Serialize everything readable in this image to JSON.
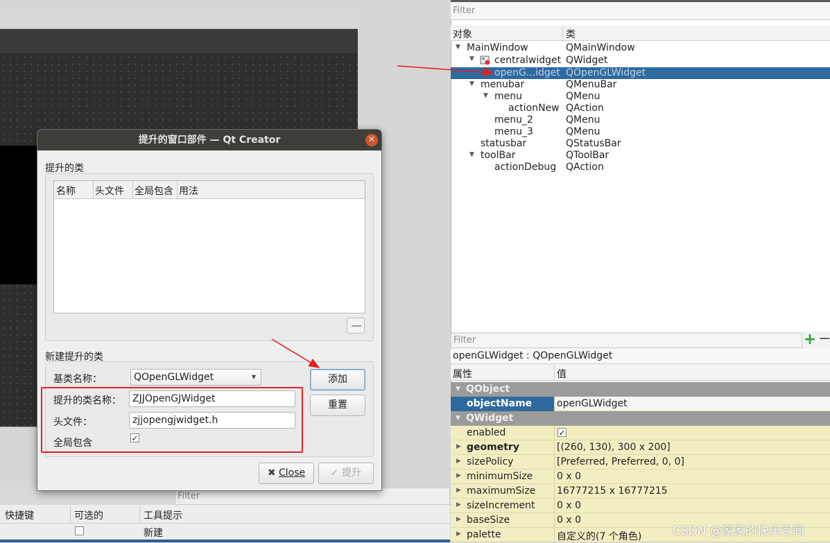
{
  "object_inspector": {
    "filter_placeholder": "Filter",
    "col_object": "对象",
    "col_class": "类",
    "rows": [
      {
        "name": "MainWindow",
        "class": "QMainWindow"
      },
      {
        "name": "centralwidget",
        "class": "QWidget"
      },
      {
        "name": "openG...idget",
        "class": "QOpenGLWidget"
      },
      {
        "name": "menubar",
        "class": "QMenuBar"
      },
      {
        "name": "menu",
        "class": "QMenu"
      },
      {
        "name": "actionNew",
        "class": "QAction"
      },
      {
        "name": "menu_2",
        "class": "QMenu"
      },
      {
        "name": "menu_3",
        "class": "QMenu"
      },
      {
        "name": "statusbar",
        "class": "QStatusBar"
      },
      {
        "name": "toolBar",
        "class": "QToolBar"
      },
      {
        "name": "actionDebug",
        "class": "QAction"
      }
    ]
  },
  "property_editor": {
    "filter_placeholder": "Filter",
    "object_label": "openGLWidget : QOpenGLWidget",
    "col_property": "属性",
    "col_value": "值",
    "group_qobject": "QObject",
    "group_qwidget": "QWidget",
    "objectName": {
      "name": "objectName",
      "value": "openGLWidget"
    },
    "enabled": {
      "name": "enabled",
      "value": "✓"
    },
    "geometry": {
      "name": "geometry",
      "value": "[(260, 130), 300 x 200]"
    },
    "sizePolicy": {
      "name": "sizePolicy",
      "value": "[Preferred, Preferred, 0, 0]"
    },
    "minimumSize": {
      "name": "minimumSize",
      "value": "0 x 0"
    },
    "maximumSize": {
      "name": "maximumSize",
      "value": "16777215 x 16777215"
    },
    "sizeIncrement": {
      "name": "sizeIncrement",
      "value": "0 x 0"
    },
    "baseSize": {
      "name": "baseSize",
      "value": "0 x 0"
    },
    "palette": {
      "name": "palette",
      "value": "自定义的(7 个角色)"
    }
  },
  "action_editor": {
    "filter_placeholder": "Filter",
    "col_shortcut": "快捷键",
    "col_checkable": "可选的",
    "col_tooltip": "工具提示",
    "row_tooltip": "新建"
  },
  "dialog": {
    "title": "提升的窗口部件 — Qt Creator",
    "promoted_classes_label": "提升的类",
    "table_headers": [
      "名称",
      "头文件",
      "全局包含",
      "用法"
    ],
    "new_promoted_label": "新建提升的类",
    "base_class_label": "基类名称：",
    "base_class_value": "QOpenGLWidget",
    "promoted_class_label": "提升的类名称：",
    "promoted_class_value": "ZJJOpenGJWidget",
    "header_file_label": "头文件：",
    "header_file_value": "zjjopengjwidget.h",
    "global_include_label": "全局包含",
    "global_include_check": "✓",
    "add_button": "添加",
    "reset_button": "重置",
    "close_button": "Close",
    "promote_button": "提升"
  },
  "watermark": "CSDN @家家的快乐空间",
  "colors": {
    "selection": "#2f6a9e",
    "annotation_red": "#e22020",
    "property_row": "#f2eec2"
  }
}
